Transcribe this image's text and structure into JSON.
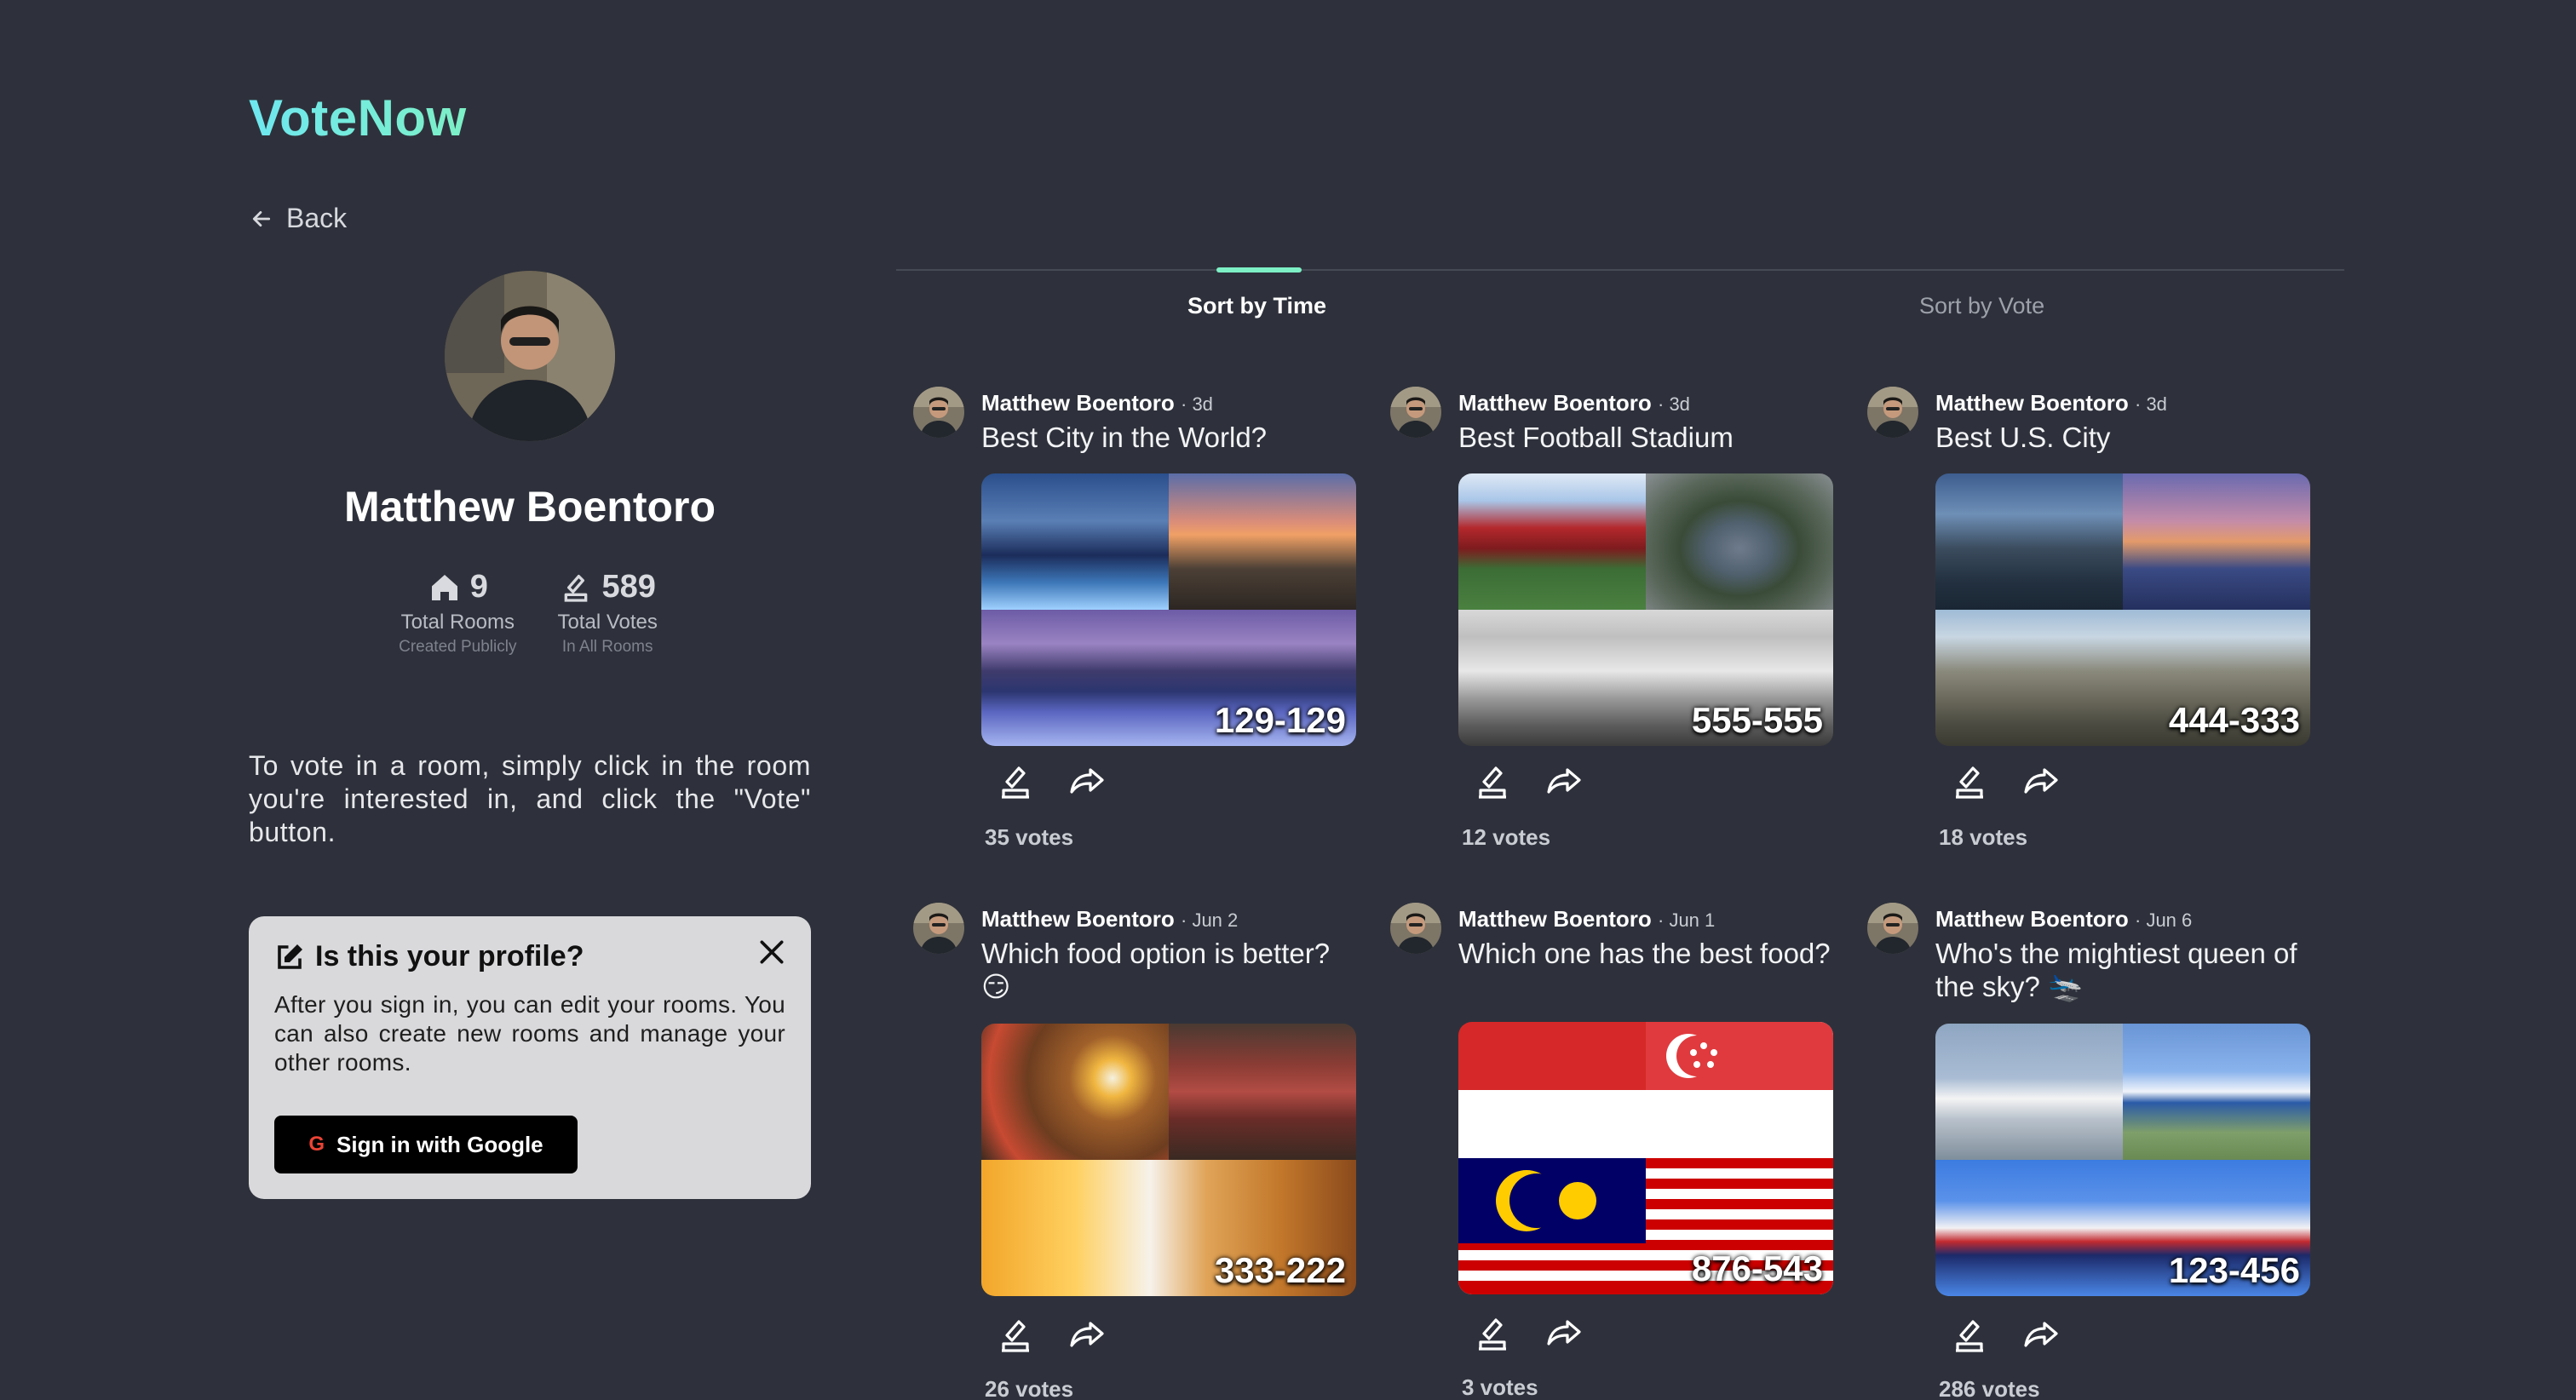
{
  "app": {
    "logo": "VoteNow",
    "back_label": "Back"
  },
  "profile": {
    "name": "Matthew Boentoro",
    "stats": [
      {
        "value": "9",
        "label": "Total Rooms",
        "sub": "Created Publicly",
        "icon": "house-icon"
      },
      {
        "value": "589",
        "label": "Total Votes",
        "sub": "In All Rooms",
        "icon": "ballot-icon"
      }
    ],
    "hint": "To vote in a room, simply click in the room you're interested in, and click the \"Vote\" button."
  },
  "signin_card": {
    "title": "Is this your profile?",
    "body": "After you sign in, you can edit your rooms. You can also create new rooms and manage your other rooms.",
    "button_label": "Sign in with Google"
  },
  "tabs": {
    "active": "Sort by Time",
    "inactive": "Sort by Vote"
  },
  "rooms": [
    {
      "author": "Matthew Boentoro",
      "time": "· 3d",
      "question": "Best City in the World?",
      "code": "129-129",
      "votes": "35 votes"
    },
    {
      "author": "Matthew Boentoro",
      "time": "· 3d",
      "question": "Best Football Stadium",
      "code": "555-555",
      "votes": "12 votes"
    },
    {
      "author": "Matthew Boentoro",
      "time": "· 3d",
      "question": "Best U.S. City",
      "code": "444-333",
      "votes": "18 votes"
    },
    {
      "author": "Matthew Boentoro",
      "time": "· Jun 2",
      "question": "Which food option is better? 😏",
      "code": "333-222",
      "votes": "26 votes"
    },
    {
      "author": "Matthew Boentoro",
      "time": "· Jun 1",
      "question": "Which one has the best food?",
      "code": "876-543",
      "votes": "3 votes"
    },
    {
      "author": "Matthew Boentoro",
      "time": "· Jun 6",
      "question": "Who's the mightiest queen of the sky? 🛬",
      "code": "123-456",
      "votes": "286 votes"
    }
  ],
  "colors": {
    "background": "#2e313b",
    "accent": "#7df0c6",
    "logo": "#6ee7f0"
  }
}
